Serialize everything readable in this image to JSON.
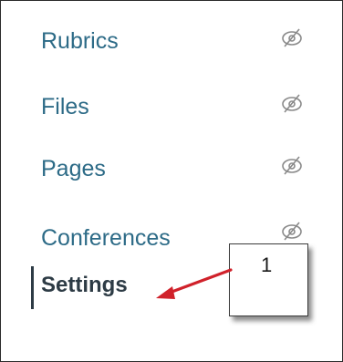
{
  "nav": {
    "items": [
      {
        "label": "Rubrics",
        "icon": "hidden-eye-icon"
      },
      {
        "label": "Files",
        "icon": "hidden-eye-icon"
      },
      {
        "label": "Pages",
        "icon": "hidden-eye-icon"
      },
      {
        "label": "Conferences",
        "icon": "hidden-eye-icon"
      }
    ],
    "active_item": {
      "label": "Settings"
    }
  },
  "annotation": {
    "callout_number": "1",
    "arrow_color": "#d0212a"
  },
  "colors": {
    "link": "#2d6b87",
    "active_text": "#2d3b45",
    "active_bar": "#2d3b45",
    "icon": "#8a8a8a"
  }
}
